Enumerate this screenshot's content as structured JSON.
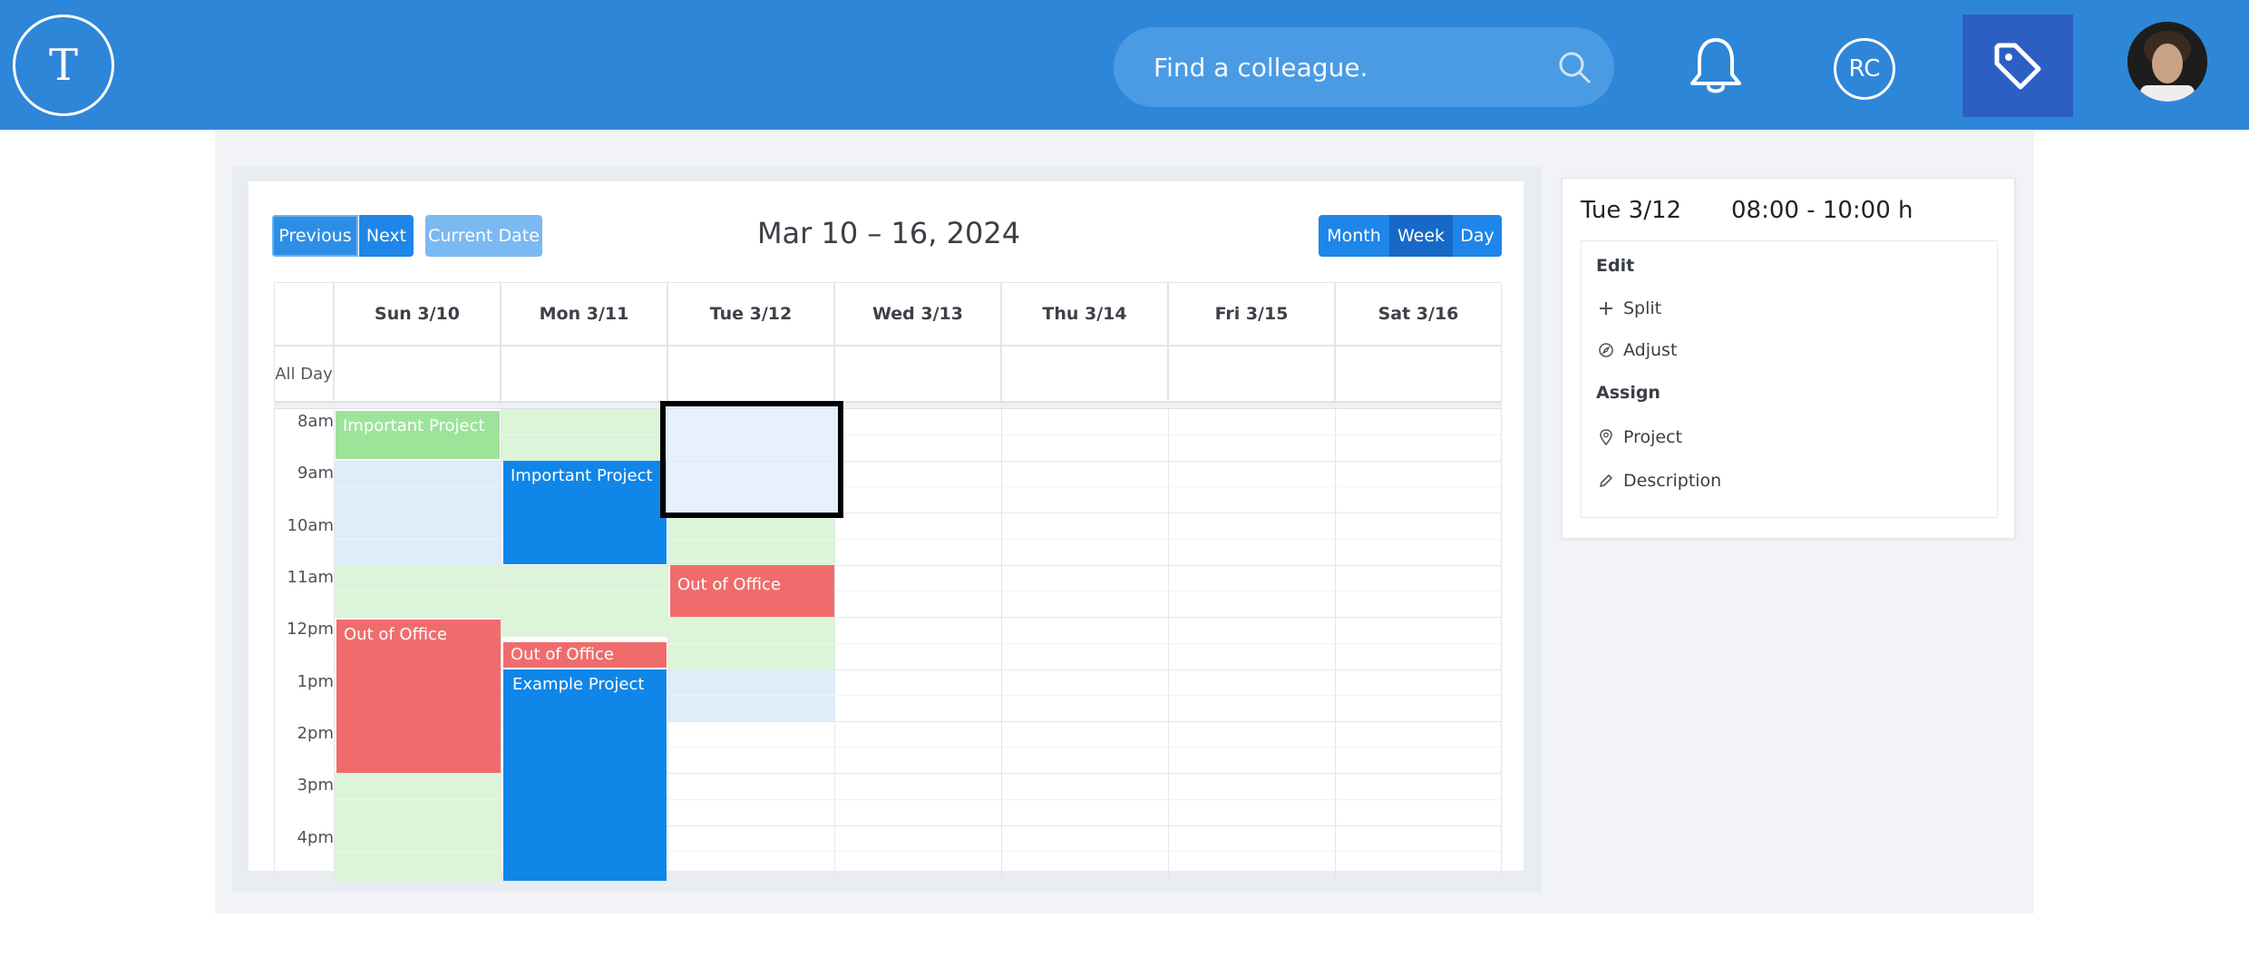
{
  "header": {
    "logo_letter": "T",
    "search_placeholder": "Find a colleague.",
    "user_initials": "RC",
    "colors": {
      "bar": "#2e86d9",
      "tag_button": "#2c5fc4"
    }
  },
  "calendar": {
    "buttons": {
      "previous": "Previous",
      "next": "Next",
      "current_date": "Current Date",
      "month": "Month",
      "week": "Week",
      "day": "Day"
    },
    "title": "Mar 10 – 16, 2024",
    "active_view": "Week",
    "days": [
      "Sun 3/10",
      "Mon 3/11",
      "Tue 3/12",
      "Wed 3/13",
      "Thu 3/14",
      "Fri 3/15",
      "Sat 3/16"
    ],
    "all_day_label": "All Day",
    "hours": [
      "8am",
      "9am",
      "10am",
      "11am",
      "12pm",
      "1pm",
      "2pm",
      "3pm",
      "4pm"
    ],
    "events": [
      {
        "title": "Important Project",
        "day": "Sun 3/10",
        "start": "8:00",
        "end": "9:00",
        "color": "green"
      },
      {
        "title": "Out of Office",
        "day": "Sun 3/10",
        "start": "12:00",
        "end": "15:00",
        "color": "red"
      },
      {
        "title": "Important Project",
        "day": "Mon 3/11",
        "start": "9:00",
        "end": "11:00",
        "color": "blue"
      },
      {
        "title": "Out of Office",
        "day": "Mon 3/11",
        "start": "12:30",
        "end": "13:00",
        "color": "red"
      },
      {
        "title": "Example Project",
        "day": "Mon 3/11",
        "start": "13:00",
        "end": "17:00",
        "color": "blue"
      },
      {
        "title": "Out of Office",
        "day": "Tue 3/12",
        "start": "11:00",
        "end": "12:00",
        "color": "red"
      }
    ],
    "selected_slot": {
      "day": "Tue 3/12",
      "start": "08:00",
      "end": "10:00"
    },
    "colors": {
      "green": "#9de49a",
      "blue": "#0f86e8",
      "red": "#f06c6c",
      "light_green": "#dcf5d9",
      "light_blue": "#dfedfa"
    }
  },
  "side_panel": {
    "date": "Tue 3/12",
    "time_range": "08:00 - 10:00 h",
    "edit_heading": "Edit",
    "split_label": "Split",
    "adjust_label": "Adjust",
    "assign_heading": "Assign",
    "project_label": "Project",
    "description_label": "Description"
  }
}
